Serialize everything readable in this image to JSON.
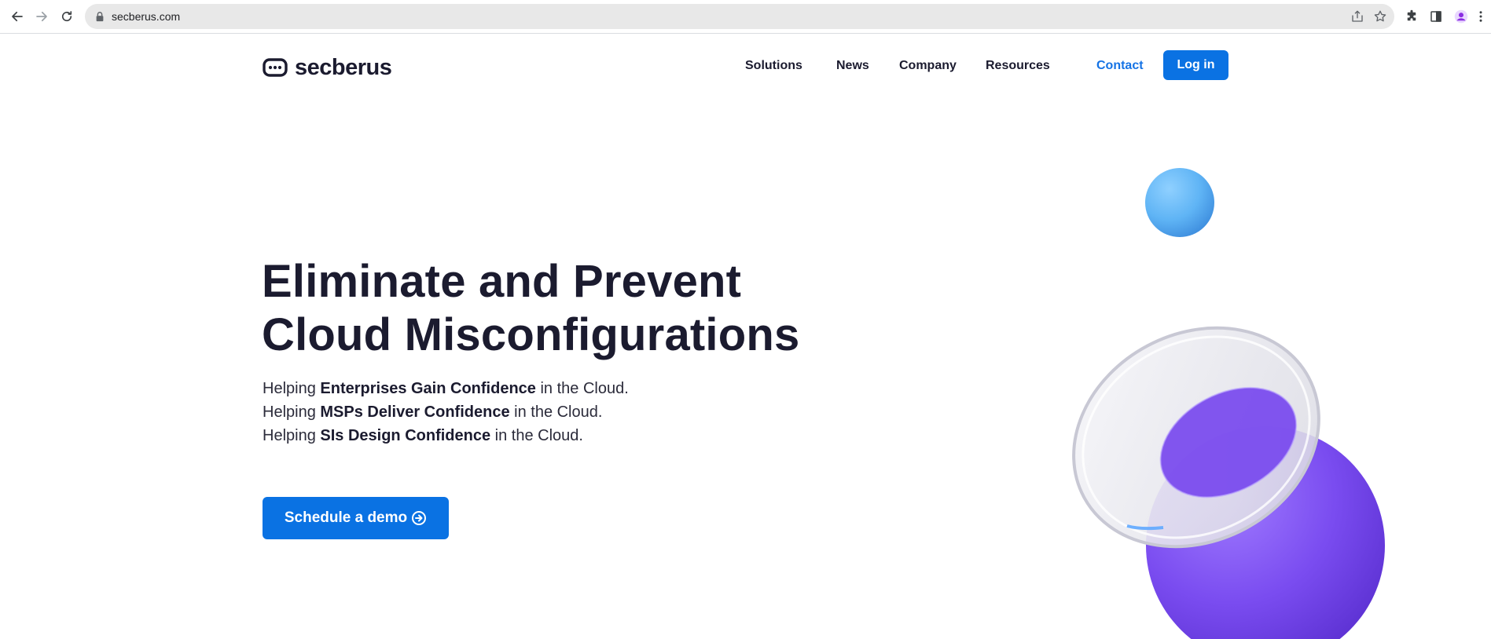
{
  "browser": {
    "url": "secberus.com",
    "icons": [
      "back-icon",
      "forward-icon",
      "reload-icon",
      "lock-icon",
      "share-icon",
      "star-icon",
      "extensions-icon",
      "side-panel-icon",
      "profile-icon",
      "menu-icon"
    ]
  },
  "header": {
    "logo_text": "secberus",
    "nav": {
      "solutions": "Solutions",
      "news": "News",
      "company": "Company",
      "resources": "Resources",
      "contact": "Contact"
    },
    "login_label": "Log in"
  },
  "hero": {
    "title_line1": "Eliminate and Prevent",
    "title_line2": "Cloud Misconfigurations",
    "lines": [
      {
        "prefix": "Helping ",
        "bold": "Enterprises Gain Confidence",
        "suffix": " in the Cloud."
      },
      {
        "prefix": "Helping ",
        "bold": "MSPs Deliver Confidence",
        "suffix": " in the Cloud."
      },
      {
        "prefix": "Helping ",
        "bold": "SIs Design Confidence",
        "suffix": " in the Cloud."
      }
    ],
    "cta_label": "Schedule a demo"
  },
  "colors": {
    "brand_blue": "#0a72e3",
    "contact_blue": "#1573e5",
    "heading": "#1b1b2f",
    "sphere_blue": "#5fb4f5",
    "sphere_purple": "#7a4cf0"
  }
}
